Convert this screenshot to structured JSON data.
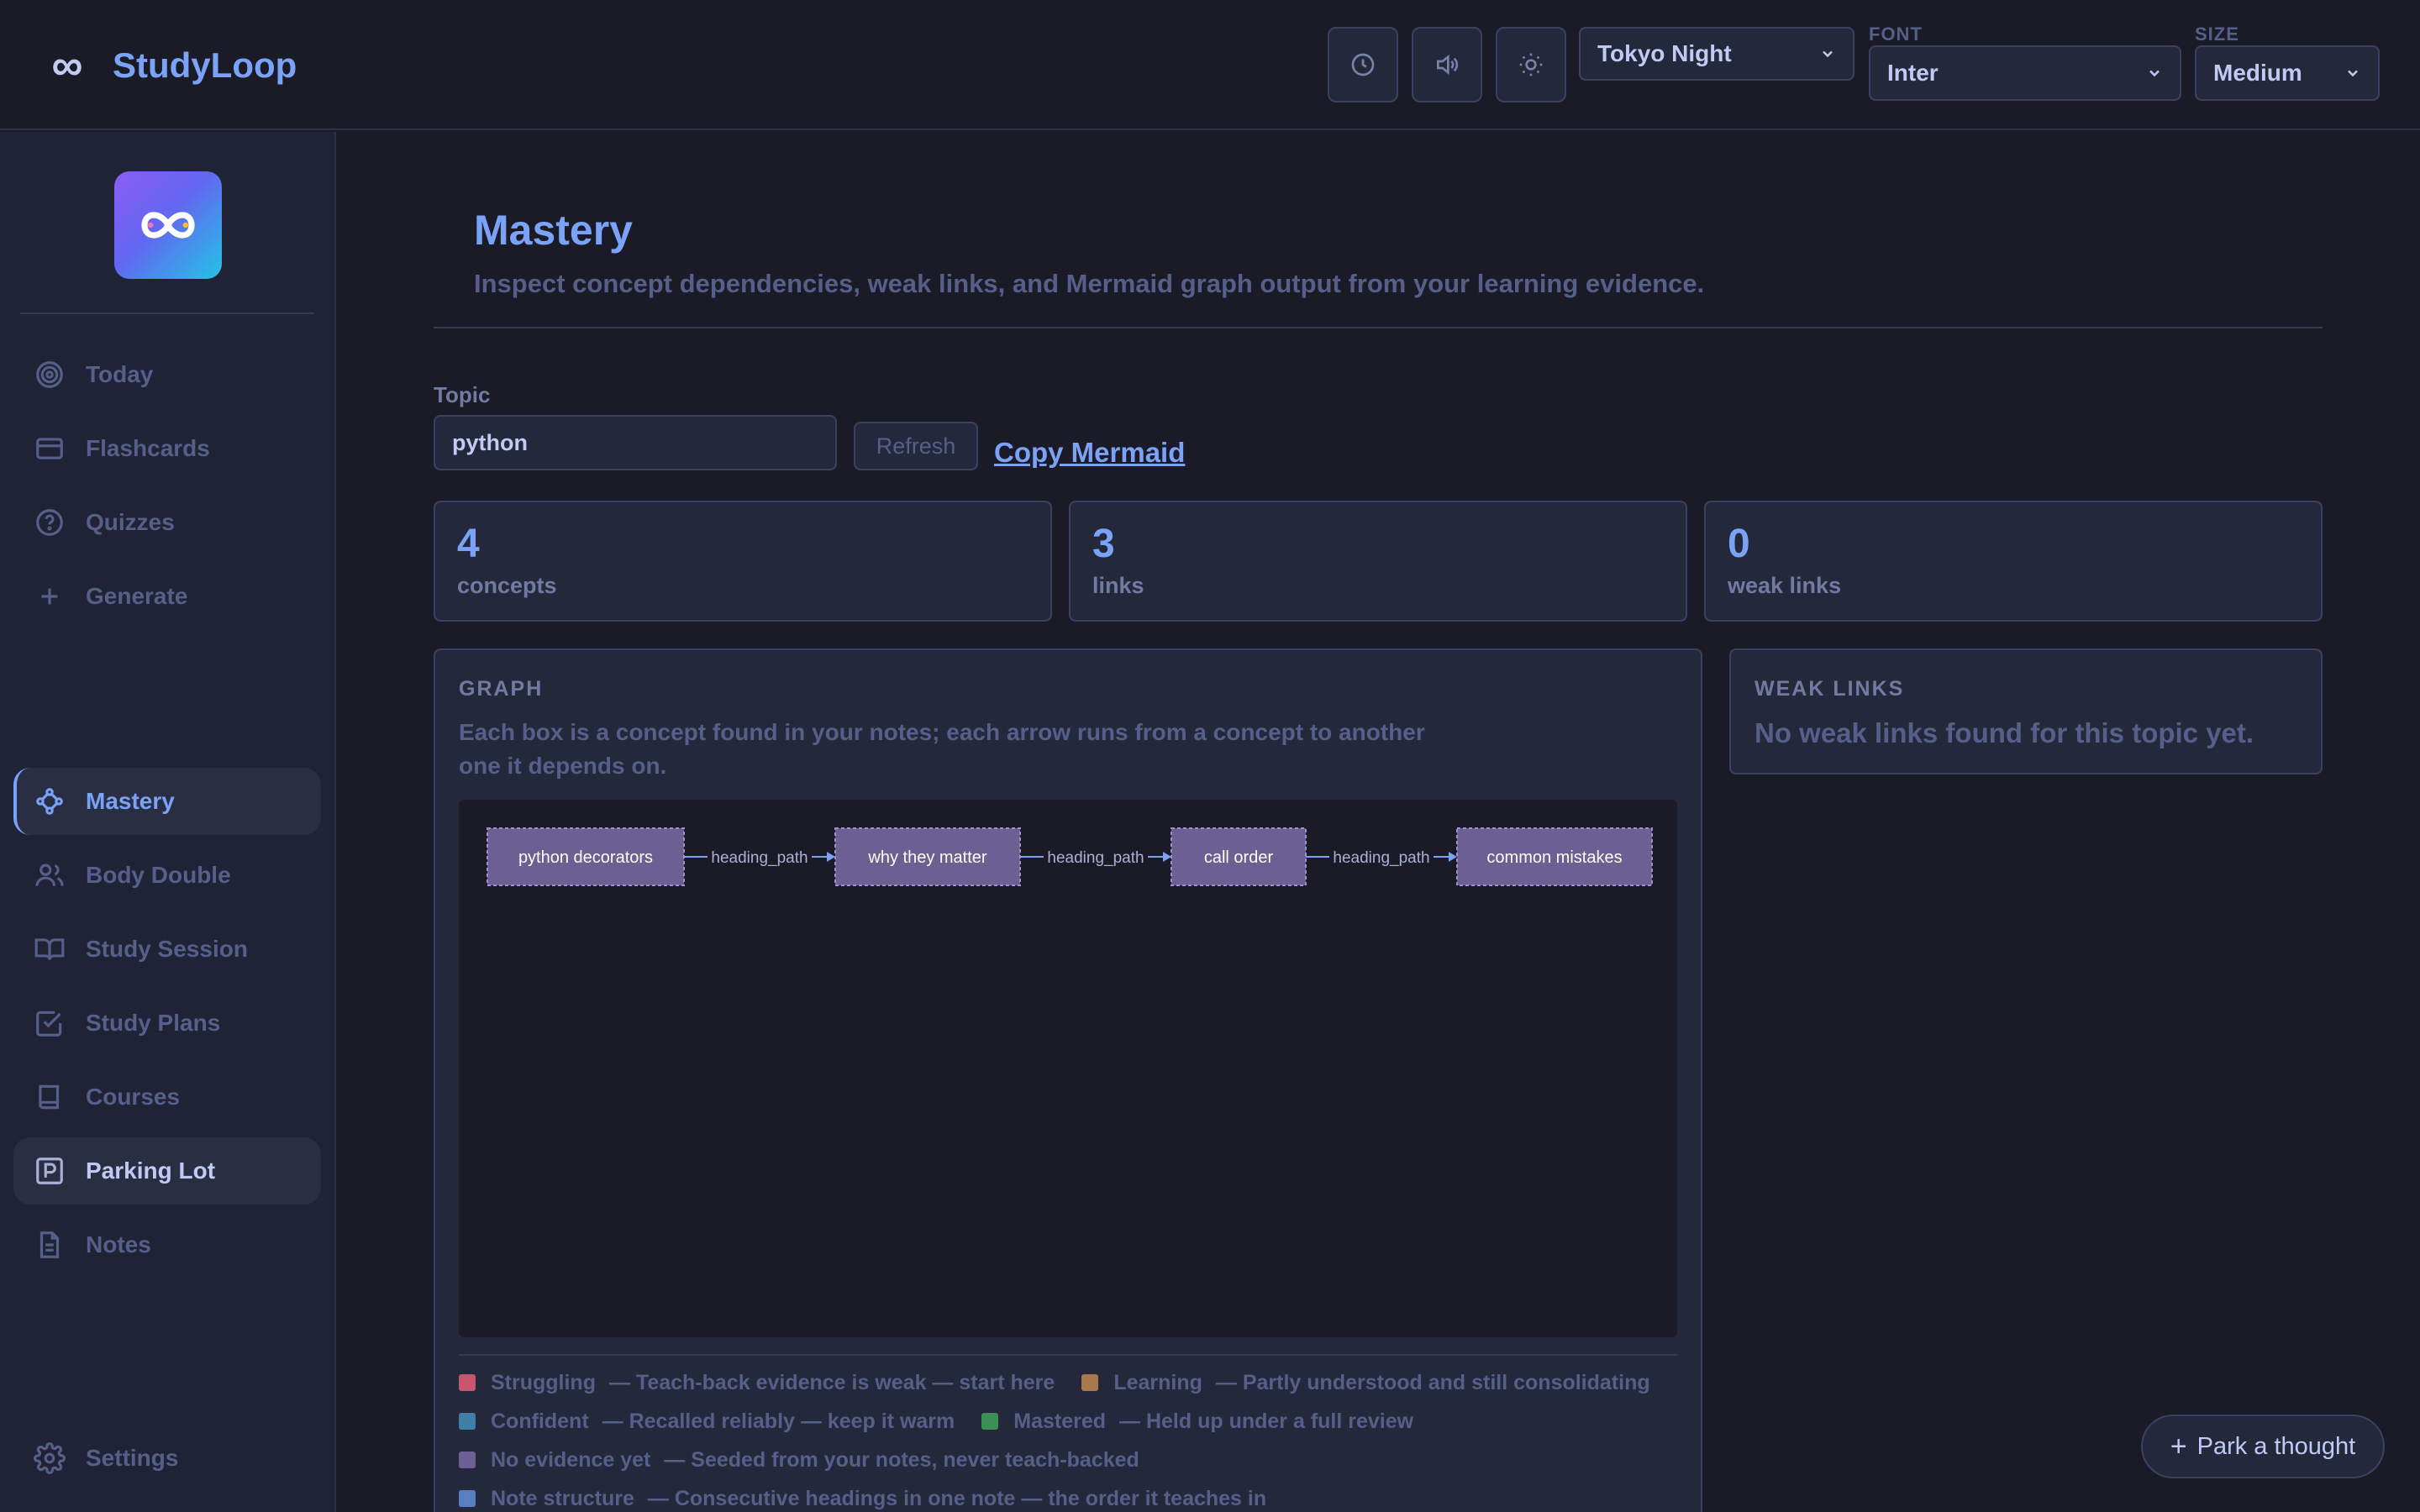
{
  "app": {
    "name": "StudyLoop",
    "brand_icon": "infinity-icon"
  },
  "header": {
    "theme": {
      "value": "Tokyo Night"
    },
    "font": {
      "label": "FONT",
      "value": "Inter"
    },
    "size": {
      "label": "SIZE",
      "value": "Medium"
    },
    "icon_buttons": [
      "clock-icon",
      "volume-icon",
      "sun-icon"
    ]
  },
  "sidebar": {
    "items": [
      {
        "label": "Today",
        "icon": "target-icon"
      },
      {
        "label": "Flashcards",
        "icon": "card-icon"
      },
      {
        "label": "Quizzes",
        "icon": "question-icon"
      },
      {
        "label": "Generate",
        "icon": "plus-icon"
      },
      {
        "label": "Mastery",
        "icon": "graph-icon",
        "active": true
      },
      {
        "label": "Body Double",
        "icon": "users-icon"
      },
      {
        "label": "Study Session",
        "icon": "book-open-icon"
      },
      {
        "label": "Study Plans",
        "icon": "checkbox-icon"
      },
      {
        "label": "Courses",
        "icon": "book-icon"
      },
      {
        "label": "Parking Lot",
        "icon": "parking-icon"
      },
      {
        "label": "Notes",
        "icon": "file-icon"
      }
    ],
    "settings": {
      "label": "Settings",
      "icon": "gear-icon"
    }
  },
  "page": {
    "title": "Mastery",
    "subtitle": "Inspect concept dependencies, weak links, and Mermaid graph output from your learning evidence."
  },
  "controls": {
    "topic_label": "Topic",
    "topic_value": "python",
    "refresh_label": "Refresh",
    "copy_label": "Copy Mermaid"
  },
  "stats": [
    {
      "value": "4",
      "label": "concepts"
    },
    {
      "value": "3",
      "label": "links"
    },
    {
      "value": "0",
      "label": "weak links"
    }
  ],
  "graph": {
    "title": "GRAPH",
    "description": "Each box is a concept found in your notes; each arrow runs from a concept to another one it depends on.",
    "nodes": [
      "python decorators",
      "why they matter",
      "call order",
      "common mistakes"
    ],
    "edges": [
      {
        "from": 0,
        "to": 1,
        "label": "heading_path"
      },
      {
        "from": 1,
        "to": 2,
        "label": "heading_path"
      },
      {
        "from": 2,
        "to": 3,
        "label": "heading_path"
      }
    ],
    "node_color": "#6b5f94",
    "legend": [
      {
        "name": "Struggling",
        "desc": "— Teach-back evidence is weak — start here",
        "color": "#c4566f"
      },
      {
        "name": "Learning",
        "desc": "— Partly understood and still consolidating",
        "color": "#a8794c"
      },
      {
        "name": "Confident",
        "desc": "— Recalled reliably — keep it warm",
        "color": "#3f7ea8"
      },
      {
        "name": "Mastered",
        "desc": "— Held up under a full review",
        "color": "#3d8f5a"
      },
      {
        "name": "No evidence yet",
        "desc": "— Seeded from your notes, never teach-backed",
        "color": "#6b5f94"
      },
      {
        "name": "Note structure",
        "desc": "— Consecutive headings in one note — the order it teaches in",
        "color": "#5a7fc0"
      }
    ]
  },
  "weak_links": {
    "title": "WEAK LINKS",
    "empty_message": "No weak links found for this topic yet."
  },
  "park": {
    "label": "Park a thought"
  }
}
